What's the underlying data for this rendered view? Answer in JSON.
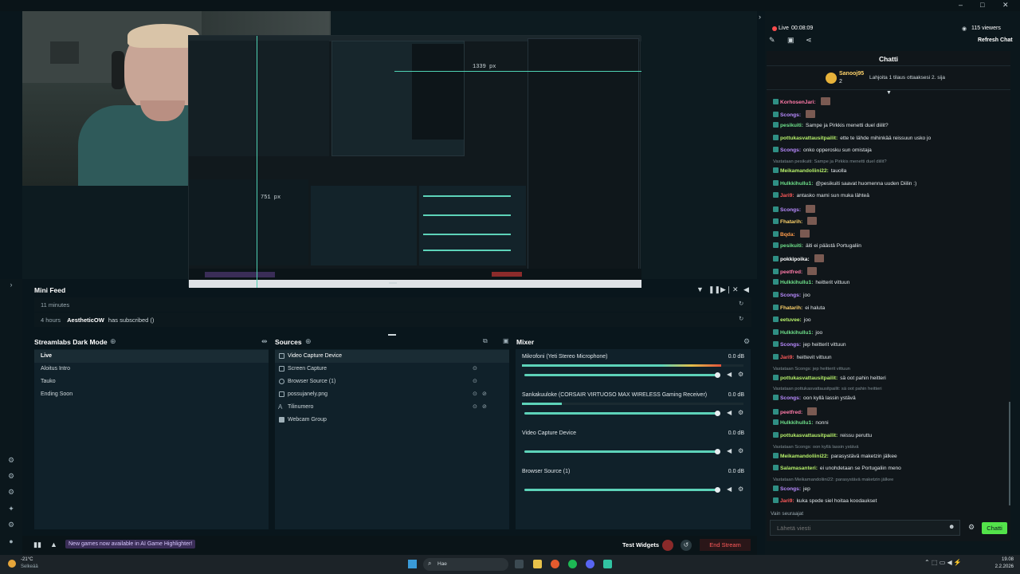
{
  "system": {
    "window_controls": [
      "–",
      "□",
      "✕"
    ]
  },
  "stream": {
    "live_label": "Live",
    "live_time": "00:08:09",
    "viewers": "115 viewers",
    "refresh_chat": "Refresh Chat"
  },
  "preview": {
    "measure_h": "1339 px",
    "measure_v": "751 px"
  },
  "mini_feed": {
    "title": "Mini Feed",
    "rows": [
      {
        "time": "11 minutes",
        "name": "",
        "text": ""
      },
      {
        "time": "4 hours",
        "name": "AestheticOW",
        "text": "has subscribed ()"
      }
    ]
  },
  "scenes": {
    "title": "Streamlabs Dark Mode",
    "items": [
      "Live",
      "Aloitus Intro",
      "Tauko",
      "Ending Soon"
    ],
    "selected": 0
  },
  "sources": {
    "title": "Sources",
    "items": [
      "Video Capture Device",
      "Screen Capture",
      "Browser Source (1)",
      "possujanely.png",
      "Tilinumero",
      "Webcam Group"
    ],
    "selected": 0
  },
  "mixer": {
    "title": "Mixer",
    "channels": [
      {
        "name": "Mikrofoni (Yeti Stereo Microphone)",
        "db": "0.0 dB",
        "level": 0.9
      },
      {
        "name": "Sankakuuloke (CORSAIR VIRTUOSO MAX WIRELESS Gaming Receiver)",
        "db": "0.0 dB",
        "level": 0.18
      },
      {
        "name": "Video Capture Device",
        "db": "0.0 dB",
        "level": 0
      },
      {
        "name": "Browser Source (1)",
        "db": "0.0 dB",
        "level": 0
      }
    ]
  },
  "actionbar": {
    "notice": "New games now available in AI Game Highlighter!",
    "test_widgets": "Test Widgets",
    "end_stream": "End Stream"
  },
  "chat": {
    "title": "Chatti",
    "pinned_user": "Sanooj95",
    "pinned_count": "2",
    "pinned_text": "Lahjoita 1 tilaus ottaaksesi 2. sija",
    "messages": [
      {
        "kind": "msg",
        "name": "KorhosenJari:",
        "color": "#ff7aa8",
        "text": ""
      },
      {
        "kind": "msg",
        "name": "Scongs:",
        "color": "#b98bff",
        "text": ""
      },
      {
        "kind": "msg",
        "name": "pesikuiti:",
        "color": "#6ee08a",
        "text": "Sampe ja Pirkkis menetti duel diilit?"
      },
      {
        "kind": "msg",
        "name": "pottukasvattausitpailit:",
        "color": "#b6f06a",
        "text": "ette te lähde mihinkää reissuun usko jo"
      },
      {
        "kind": "msg",
        "name": "Scongs:",
        "color": "#b98bff",
        "text": "onko opperosku sun omistaja"
      },
      {
        "kind": "reply",
        "text": "Vastataan pesikuiti: Sampe ja Pirkkis menetti duel diilit?"
      },
      {
        "kind": "msg",
        "name": "Meikamandoliini22:",
        "color": "#b6f06a",
        "text": "tauolla"
      },
      {
        "kind": "msg",
        "name": "Hulkkihullu1:",
        "color": "#6ee08a",
        "text": "@pesikuiti saavat huomenna uuden Diilin :)"
      },
      {
        "kind": "msg",
        "name": "Jari9:",
        "color": "#ff5a5a",
        "text": "antasko mami sun muka lähteä"
      },
      {
        "kind": "msg",
        "name": "Scongs:",
        "color": "#b98bff",
        "text": ""
      },
      {
        "kind": "msg",
        "name": "Fhatarih:",
        "color": "#ffd36b",
        "text": ""
      },
      {
        "kind": "msg",
        "name": "Bqda:",
        "color": "#ff9b4a",
        "text": ""
      },
      {
        "kind": "msg",
        "name": "pesikuiti:",
        "color": "#6ee08a",
        "text": "äiti ei päästä Portugaliin"
      },
      {
        "kind": "msg",
        "name": "pokkipoika:",
        "color": "#ffffff",
        "text": ""
      },
      {
        "kind": "msg",
        "name": "peetfred:",
        "color": "#ff7aa8",
        "text": ""
      },
      {
        "kind": "msg",
        "name": "Hulkkihullu1:",
        "color": "#6ee08a",
        "text": "heitterit vittuun"
      },
      {
        "kind": "msg",
        "name": "Scongs:",
        "color": "#b98bff",
        "text": "joo"
      },
      {
        "kind": "msg",
        "name": "Fhatarih:",
        "color": "#ffd36b",
        "text": "ei haluta"
      },
      {
        "kind": "msg",
        "name": "eetuveе:",
        "color": "#b6f06a",
        "text": "joo"
      },
      {
        "kind": "msg",
        "name": "Hulkkihullu1:",
        "color": "#6ee08a",
        "text": "joo"
      },
      {
        "kind": "msg",
        "name": "Scongs:",
        "color": "#b98bff",
        "text": "jep heitterit vittuun"
      },
      {
        "kind": "msg",
        "name": "Jari9:",
        "color": "#ff5a5a",
        "text": "heittevit vittuun"
      },
      {
        "kind": "reply",
        "text": "Vastataan Scongs: jep heitterit vittuun"
      },
      {
        "kind": "msg",
        "name": "pottukasvattausitpailit:",
        "color": "#b6f06a",
        "text": "sä oot pahin heitteri"
      },
      {
        "kind": "reply",
        "text": "Vastataan pottukasvattausitpailit: sä oot pahin heitteri"
      },
      {
        "kind": "msg",
        "name": "Scongs:",
        "color": "#b98bff",
        "text": "oon kyllä lassin ystävä"
      },
      {
        "kind": "msg",
        "name": "peetfred:",
        "color": "#ff7aa8",
        "text": ""
      },
      {
        "kind": "msg",
        "name": "Hulkkihullu1:",
        "color": "#6ee08a",
        "text": "nonni"
      },
      {
        "kind": "msg",
        "name": "pottukasvattausitpailit:",
        "color": "#b6f06a",
        "text": "reissu peruttu"
      },
      {
        "kind": "reply",
        "text": "Vastataan Scongs: oon kyllä lassin ystävä"
      },
      {
        "kind": "msg",
        "name": "Meikamandoliini22:",
        "color": "#b6f06a",
        "text": "parasystävä maketzin jälkee"
      },
      {
        "kind": "msg",
        "name": "Salamasanteri:",
        "color": "#b6f06a",
        "text": "ei unohdetaan se Portugaliin meno"
      },
      {
        "kind": "reply",
        "text": "Vastataan Meikamandoliini22: parasystävä maketzin jälkee"
      },
      {
        "kind": "msg",
        "name": "Scongs:",
        "color": "#b98bff",
        "text": "jep"
      },
      {
        "kind": "msg",
        "name": "Jari9:",
        "color": "#ff5a5a",
        "text": "kuka spede siel hoitaa koodaukset"
      }
    ],
    "followers_only": "Vain seuraajat",
    "input_placeholder": "Lähetä viesti",
    "send_label": "Chatti"
  },
  "taskbar": {
    "weather_temp": "-21°C",
    "weather_desc": "Selkeää",
    "search_placeholder": "Hae",
    "time": "19.08",
    "date": "2.2.2026"
  }
}
